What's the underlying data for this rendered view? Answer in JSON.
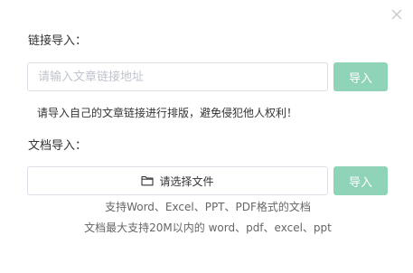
{
  "link_section": {
    "label": "链接导入：",
    "input_placeholder": "请输入文章链接地址",
    "input_value": "",
    "import_button": "导入",
    "hint": "请导入自己的文章链接进行排版，避免侵犯他人权利！"
  },
  "doc_section": {
    "label": "文档导入：",
    "file_button": "请选择文件",
    "import_button": "导入",
    "note_formats": "支持Word、Excel、PPT、PDF格式的文档",
    "note_size": "文档最大支持20M以内的 word、pdf、excel、ppt"
  },
  "colors": {
    "accent": "#8fd3b8",
    "border": "#dcdfe6",
    "placeholder": "#c0c4cc",
    "close": "#c8c8c8"
  },
  "icons": {
    "close": "close-icon",
    "folder": "folder-icon"
  }
}
